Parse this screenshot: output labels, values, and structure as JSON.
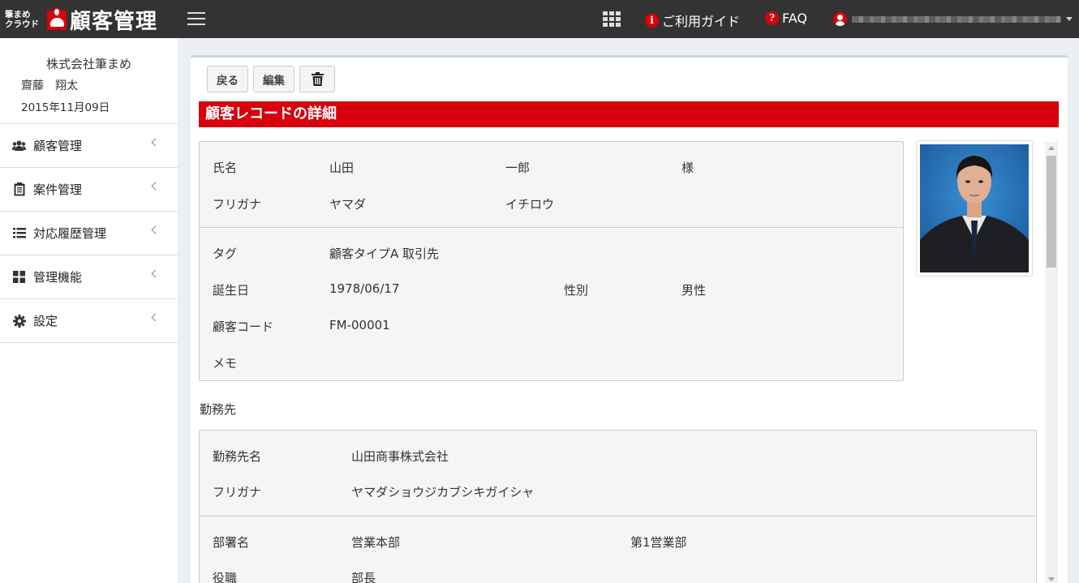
{
  "header": {
    "logo_small_line1": "筆まめ",
    "logo_small_line2": "クラウド",
    "logo_title": "顧客管理",
    "guide_label": "ご利用ガイド",
    "faq_label": "FAQ",
    "brand_color": "#d9000d",
    "bar_color": "#333333"
  },
  "sidebar": {
    "company": "株式会社筆まめ",
    "user_name": "齋藤　翔太",
    "date": "2015年11月09日",
    "items": [
      {
        "label": "顧客管理",
        "icon": "users-icon"
      },
      {
        "label": "案件管理",
        "icon": "clipboard-icon"
      },
      {
        "label": "対応履歴管理",
        "icon": "list-icon"
      },
      {
        "label": "管理機能",
        "icon": "grid-icon"
      },
      {
        "label": "設定",
        "icon": "gear-icon"
      }
    ]
  },
  "toolbar": {
    "back_label": "戻る",
    "edit_label": "編集",
    "delete_icon": "trash-icon"
  },
  "detail": {
    "section_title": "顧客レコードの詳細",
    "name_label": "氏名",
    "last_name": "山田",
    "first_name": "一郎",
    "honorific": "様",
    "furigana_label": "フリガナ",
    "last_kana": "ヤマダ",
    "first_kana": "イチロウ",
    "tag_label": "タグ",
    "tag_value": "顧客タイプA 取引先",
    "birthday_label": "誕生日",
    "birthday_value": "1978/06/17",
    "gender_label": "性別",
    "gender_value": "男性",
    "code_label": "顧客コード",
    "code_value": "FM-00001",
    "memo_label": "メモ"
  },
  "work": {
    "section_label": "勤務先",
    "company_label": "勤務先名",
    "company_value": "山田商事株式会社",
    "furigana_label": "フリガナ",
    "furigana_value": "ヤマダショウジカブシキガイシャ",
    "dept_label": "部署名",
    "dept_value": "営業本部",
    "dept_sub_value": "第1営業部",
    "position_label": "役職",
    "position_value": "部長"
  }
}
